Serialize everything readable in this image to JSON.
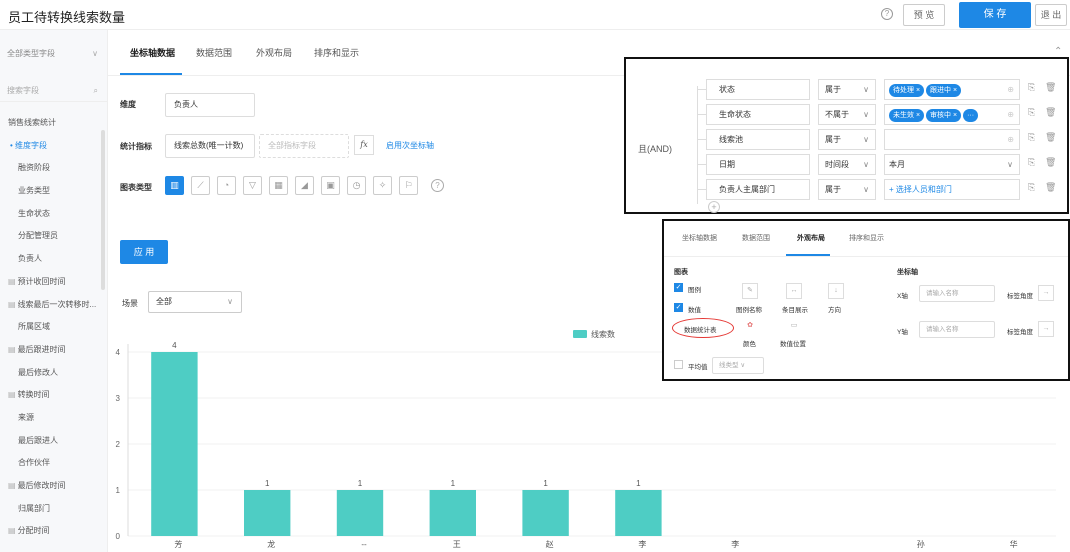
{
  "header": {
    "title": "员工待转换线索数量",
    "help_icon": "?",
    "preview_label": "预 览",
    "save_label": "保 存",
    "exit_label": "退 出"
  },
  "sidebar": {
    "type_select": "全部类型字段",
    "search_placeholder": "搜索字段",
    "items": [
      {
        "label": "销售线索统计",
        "kind": "header"
      },
      {
        "label": "• 维度字段",
        "kind": "active"
      },
      {
        "label": "融资阶段",
        "kind": "sub"
      },
      {
        "label": "业务类型",
        "kind": "sub"
      },
      {
        "label": "生命状态",
        "kind": "sub"
      },
      {
        "label": "分配管理员",
        "kind": "sub"
      },
      {
        "label": "负责人",
        "kind": "sub"
      },
      {
        "label": "预计收回时间",
        "kind": "grp"
      },
      {
        "label": "线索最后一次转移时...",
        "kind": "grp"
      },
      {
        "label": "所属区域",
        "kind": "sub"
      },
      {
        "label": "最后跟进时间",
        "kind": "grp"
      },
      {
        "label": "最后修改人",
        "kind": "sub"
      },
      {
        "label": "转换时间",
        "kind": "grp"
      },
      {
        "label": "来源",
        "kind": "sub"
      },
      {
        "label": "最后跟进人",
        "kind": "sub"
      },
      {
        "label": "合作伙伴",
        "kind": "sub"
      },
      {
        "label": "最后修改时间",
        "kind": "grp"
      },
      {
        "label": "归属部门",
        "kind": "sub"
      },
      {
        "label": "分配时间",
        "kind": "grp"
      }
    ]
  },
  "tabs": [
    "坐标轴数据",
    "数据范围",
    "外观布局",
    "排序和显示"
  ],
  "config": {
    "dimension_label": "维度",
    "dimension_value": "负责人",
    "metric_label": "统计指标",
    "metric_value": "线索总数(唯一计数)",
    "metric_placeholder": "全部指标字段",
    "fx_label": "fx",
    "secondary_axis_link": "启用次坐标轴",
    "chart_type_label": "图表类型",
    "apply_label": "应 用",
    "scene_label": "场景",
    "scene_value": "全部"
  },
  "conditions": {
    "logic_label": "且(AND)",
    "rows": [
      {
        "field": "状态",
        "op": "属于",
        "tags": [
          "待处理 ×",
          "跟进中 ×"
        ],
        "value": "",
        "kind": "tags"
      },
      {
        "field": "生命状态",
        "op": "不属于",
        "tags": [
          "未生效 ×",
          "审核中 ×",
          "···"
        ],
        "value": "",
        "kind": "tags"
      },
      {
        "field": "线索池",
        "op": "属于",
        "tags": [],
        "value": "",
        "kind": "empty"
      },
      {
        "field": "日期",
        "op": "时间段",
        "tags": [],
        "value": "本月",
        "kind": "select"
      },
      {
        "field": "负责人主属部门",
        "op": "属于",
        "tags": [],
        "value": "+ 选择人员和部门",
        "kind": "link"
      }
    ]
  },
  "layout_panel": {
    "tabs": [
      "坐标轴数据",
      "数据范围",
      "外观布局",
      "排序和显示"
    ],
    "chart_section": "图表",
    "legend": "图例",
    "value": "数值",
    "data_stat": "数据统计表",
    "legend_name": "图例名称",
    "item_display": "条目展示",
    "direction": "方向",
    "color": "颜色",
    "value_position": "数值位置",
    "average": "平均值",
    "line_type": "线类型",
    "axis_section": "坐标轴",
    "x_axis": "X轴",
    "y_axis": "Y轴",
    "name_placeholder": "请输入名称",
    "label_angle": "标签角度",
    "arrow": "→"
  },
  "chart_data": {
    "type": "bar",
    "categories": [
      "芳",
      "龙",
      "--",
      "王",
      "赵",
      "李",
      "李",
      "",
      "孙",
      "华"
    ],
    "values": [
      4,
      1,
      1,
      1,
      1,
      1,
      null,
      null,
      null,
      null
    ],
    "series": [
      {
        "name": "线索数",
        "values": [
          4,
          1,
          1,
          1,
          1,
          1,
          null,
          null,
          null,
          null
        ]
      }
    ],
    "yticks": [
      "0",
      "1",
      "2",
      "3",
      "4"
    ],
    "ylim": [
      0,
      4
    ],
    "color": "#4ecdc4",
    "legend_position": "top-center"
  }
}
